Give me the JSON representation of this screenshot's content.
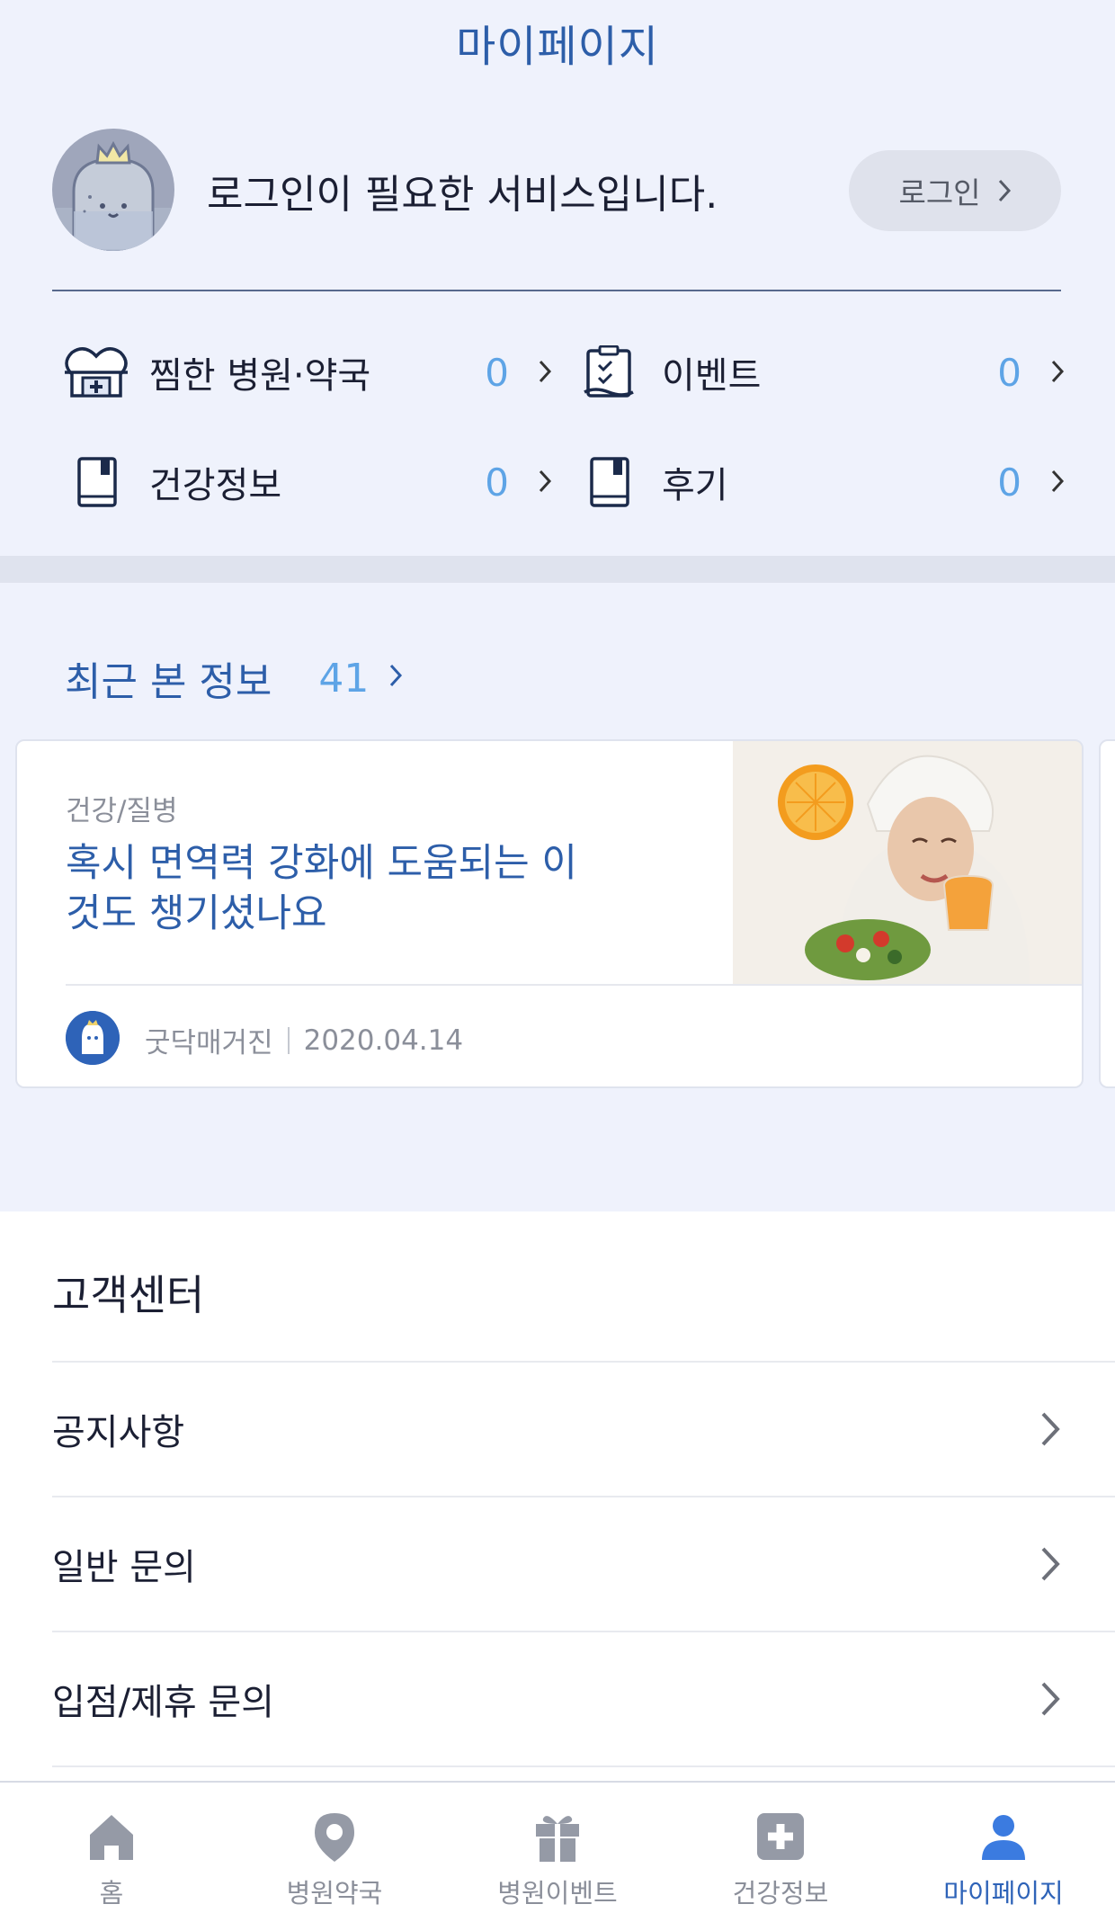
{
  "header": {
    "title": "마이페이지"
  },
  "profile": {
    "message": "로그인이 필요한 서비스입니다.",
    "login_label": "로그인"
  },
  "stats": [
    {
      "label": "찜한 병원·약국",
      "count": "0",
      "icon": "hospital-heart-icon"
    },
    {
      "label": "이벤트",
      "count": "0",
      "icon": "clipboard-check-icon"
    },
    {
      "label": "건강정보",
      "count": "0",
      "icon": "book-icon"
    },
    {
      "label": "후기",
      "count": "0",
      "icon": "book-icon"
    }
  ],
  "recent": {
    "title": "최근 본 정보",
    "count": "41",
    "card": {
      "category": "건강/질병",
      "title": "혹시 면역력 강화에 도움되는 이것도 챙기셨나요",
      "source": "굿닥매거진",
      "date": "2020.04.14"
    }
  },
  "support": {
    "title": "고객센터",
    "items": [
      "공지사항",
      "일반 문의",
      "입점/제휴 문의"
    ]
  },
  "tabbar": {
    "items": [
      {
        "label": "홈",
        "icon": "home-icon"
      },
      {
        "label": "병원약국",
        "icon": "location-pin-icon"
      },
      {
        "label": "병원이벤트",
        "icon": "gift-icon"
      },
      {
        "label": "건강정보",
        "icon": "medical-cross-icon"
      },
      {
        "label": "마이페이지",
        "icon": "person-icon"
      }
    ],
    "active_index": 4
  },
  "colors": {
    "brand_blue": "#2d5ea9",
    "count_blue": "#5ea4e6",
    "background": "#eff2fc",
    "inactive_gray": "#8b8f9a"
  }
}
